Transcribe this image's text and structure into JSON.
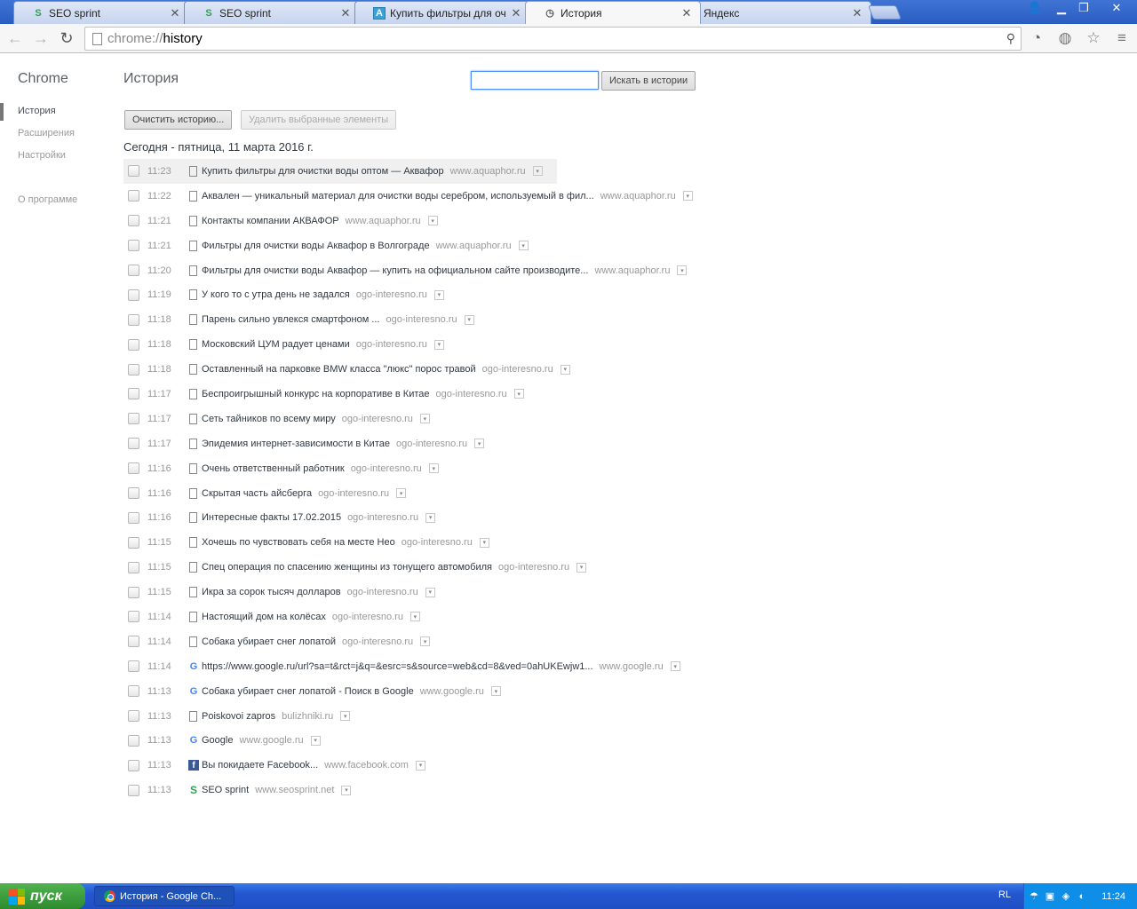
{
  "browser": {
    "tabs": [
      {
        "title": "SEO sprint",
        "icon": "seosprint-icon"
      },
      {
        "title": "SEO sprint",
        "icon": "seosprint-icon"
      },
      {
        "title": "Купить фильтры для очистки",
        "icon": "aquaphor-icon"
      },
      {
        "title": "История",
        "icon": "history-icon"
      },
      {
        "title": "Яндекс",
        "icon": "none"
      }
    ],
    "url_scheme": "chrome://",
    "url_host": "history"
  },
  "sidebar": {
    "brand": "Chrome",
    "items": [
      {
        "label": "История"
      },
      {
        "label": "Расширения"
      },
      {
        "label": "Настройки"
      },
      {
        "label": "О программе"
      }
    ]
  },
  "main": {
    "title": "История",
    "search_value": "",
    "search_button": "Искать в истории",
    "clear_button": "Очистить историю...",
    "delete_button": "Удалить выбранные элементы",
    "day_header": "Сегодня - пятница, 11 марта 2016 г."
  },
  "entries": [
    {
      "time": "11:23",
      "icon": "doc",
      "title": "Купить фильтры для очистки воды оптом — Аквафор",
      "domain": "www.aquaphor.ru"
    },
    {
      "time": "11:22",
      "icon": "doc",
      "title": "Аквален — уникальный материал для очистки воды серебром, используемый в фил...",
      "domain": "www.aquaphor.ru"
    },
    {
      "time": "11:21",
      "icon": "doc",
      "title": "Контакты компании АКВАФОР",
      "domain": "www.aquaphor.ru"
    },
    {
      "time": "11:21",
      "icon": "doc",
      "title": "Фильтры для очистки воды Аквафор в Волгограде",
      "domain": "www.aquaphor.ru"
    },
    {
      "time": "11:20",
      "icon": "doc",
      "title": "Фильтры для очистки воды Аквафор — купить на официальном сайте производите...",
      "domain": "www.aquaphor.ru"
    },
    {
      "time": "11:19",
      "icon": "doc",
      "title": "У кого то с утра день не задался",
      "domain": "ogo-interesno.ru"
    },
    {
      "time": "11:18",
      "icon": "doc",
      "title": "Парень сильно увлекся смартфоном ...",
      "domain": "ogo-interesno.ru"
    },
    {
      "time": "11:18",
      "icon": "doc",
      "title": "Московский ЦУМ радует ценами",
      "domain": "ogo-interesno.ru"
    },
    {
      "time": "11:18",
      "icon": "doc",
      "title": "Оставленный на парковке BMW класса \"люкс\" порос травой",
      "domain": "ogo-interesno.ru"
    },
    {
      "time": "11:17",
      "icon": "doc",
      "title": "Беспроигрышный конкурс на корпоративе в Китае",
      "domain": "ogo-interesno.ru"
    },
    {
      "time": "11:17",
      "icon": "doc",
      "title": "Сеть тайников по всему миру",
      "domain": "ogo-interesno.ru"
    },
    {
      "time": "11:17",
      "icon": "doc",
      "title": "Эпидемия интернет-зависимости в Китае",
      "domain": "ogo-interesno.ru"
    },
    {
      "time": "11:16",
      "icon": "doc",
      "title": "Очень ответственный работник",
      "domain": "ogo-interesno.ru"
    },
    {
      "time": "11:16",
      "icon": "doc",
      "title": "Скрытая часть айсберга",
      "domain": "ogo-interesno.ru"
    },
    {
      "time": "11:16",
      "icon": "doc",
      "title": "Интересные факты 17.02.2015",
      "domain": "ogo-interesno.ru"
    },
    {
      "time": "11:15",
      "icon": "doc",
      "title": "Хочешь по чувствовать себя на месте Нео",
      "domain": "ogo-interesno.ru"
    },
    {
      "time": "11:15",
      "icon": "doc",
      "title": "Спец операция по спасению женщины из тонущего автомобиля",
      "domain": "ogo-interesno.ru"
    },
    {
      "time": "11:15",
      "icon": "doc",
      "title": "Икра за сорок тысяч долларов",
      "domain": "ogo-interesno.ru"
    },
    {
      "time": "11:14",
      "icon": "doc",
      "title": "Настоящий дом на колёсах",
      "domain": "ogo-interesno.ru"
    },
    {
      "time": "11:14",
      "icon": "doc",
      "title": "Собака убирает снег лопатой",
      "domain": "ogo-interesno.ru"
    },
    {
      "time": "11:14",
      "icon": "google",
      "title": "https://www.google.ru/url?sa=t&rct=j&q=&esrc=s&source=web&cd=8&ved=0ahUKEwjw1...",
      "domain": "www.google.ru"
    },
    {
      "time": "11:13",
      "icon": "google",
      "title": "Собака убирает снег лопатой - Поиск в Google",
      "domain": "www.google.ru"
    },
    {
      "time": "11:13",
      "icon": "doc",
      "title": "Poiskovoi zapros",
      "domain": "bulizhniki.ru"
    },
    {
      "time": "11:13",
      "icon": "google",
      "title": "Google",
      "domain": "www.google.ru"
    },
    {
      "time": "11:13",
      "icon": "facebook",
      "title": "Вы покидаете Facebook...",
      "domain": "www.facebook.com"
    },
    {
      "time": "11:13",
      "icon": "seosprint",
      "title": "SEO sprint",
      "domain": "www.seosprint.net"
    }
  ],
  "taskbar": {
    "start_label": "пуск",
    "task_label": "История - Google Ch...",
    "lang": "RL",
    "clock": "11:24"
  }
}
